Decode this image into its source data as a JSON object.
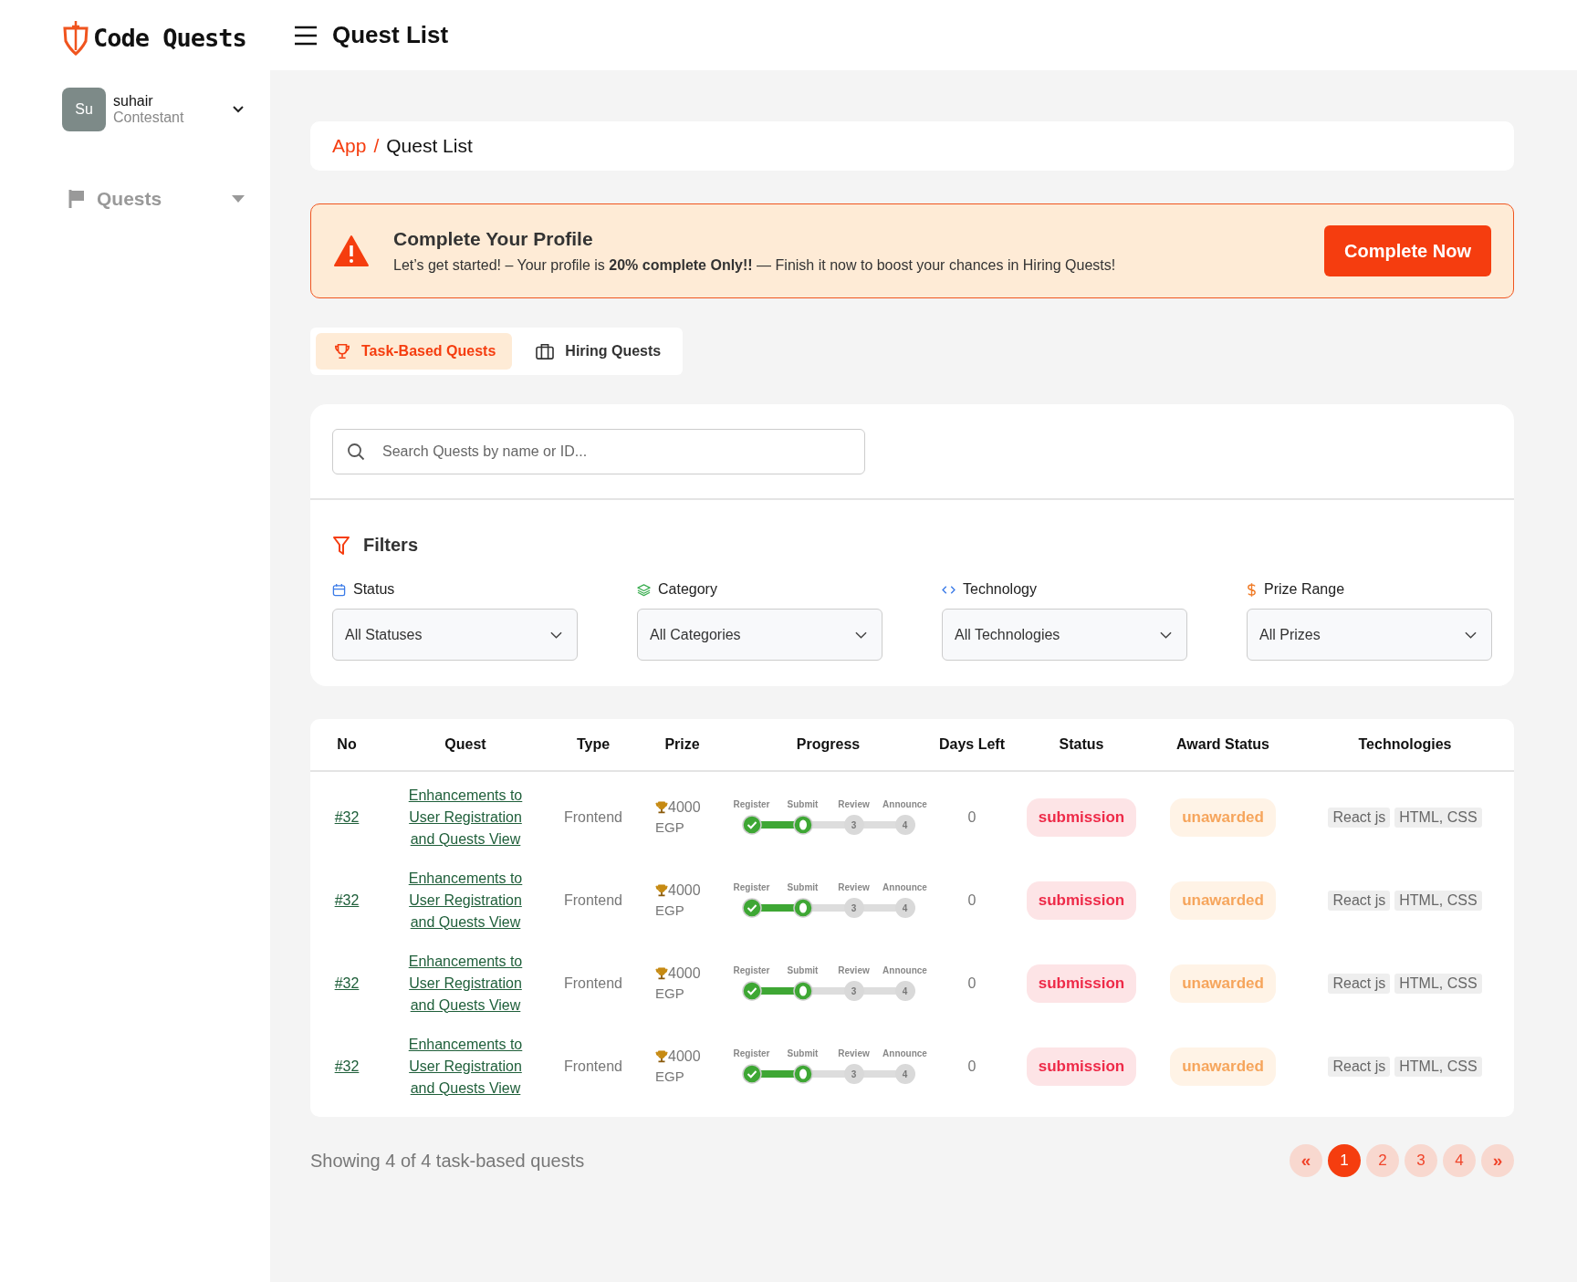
{
  "brand": {
    "name": "Code Quests"
  },
  "user": {
    "initials": "Su",
    "name": "suhair",
    "role": "Contestant"
  },
  "sidebar": {
    "items": [
      {
        "label": "Quests",
        "expanded": false
      }
    ]
  },
  "header": {
    "title": "Quest List"
  },
  "breadcrumb": [
    {
      "label": "App",
      "kind": "link"
    },
    {
      "label": "/",
      "kind": "separator"
    },
    {
      "label": "Quest List",
      "kind": "current"
    }
  ],
  "alert": {
    "title": "Complete Your Profile",
    "message": "Let’s get started! – Your profile is **20% complete Only!!** — Finish it now to boost your chances in Hiring Quests!",
    "button": "Complete Now"
  },
  "tabs": [
    {
      "label": "Task-Based Quests",
      "kind": "trophy",
      "selected": true
    },
    {
      "label": "Hiring Quests",
      "kind": "briefcase",
      "selected": false
    }
  ],
  "search": {
    "placeholder": "Search Quests by name or ID..."
  },
  "filters": {
    "title": "Filters",
    "items": [
      {
        "label": "Status",
        "kind": "calendar",
        "value": "All Statuses"
      },
      {
        "label": "Category",
        "kind": "layers",
        "value": "All Categories"
      },
      {
        "label": "Technology",
        "kind": "code",
        "value": "All Technologies"
      },
      {
        "label": "Prize Range",
        "kind": "dollar",
        "value": "All Prizes"
      }
    ]
  },
  "table": {
    "columns": [
      "No",
      "Quest",
      "Type",
      "Prize",
      "Progress",
      "Days Left",
      "Status",
      "Award Status",
      "Technologies"
    ],
    "rows": [
      {
        "no": "#32",
        "quest": "Enhancements to User Registration and Quests View",
        "type": "Frontend",
        "prize": "4000",
        "currency": "EGP",
        "steps": [
          {
            "label": "Register",
            "kind": "done"
          },
          {
            "label": "Submit",
            "kind": "current"
          },
          {
            "label": "Review",
            "kind": "pending",
            "number": "3"
          },
          {
            "label": "Announce",
            "kind": "pending",
            "number": "4"
          }
        ],
        "days_left": "0",
        "status": "submission",
        "award_status": "unawarded",
        "technologies": [
          "React js",
          "HTML, CSS"
        ]
      },
      {
        "no": "#32",
        "quest": "Enhancements to User Registration and Quests View",
        "type": "Frontend",
        "prize": "4000",
        "currency": "EGP",
        "steps": [
          {
            "label": "Register",
            "kind": "done"
          },
          {
            "label": "Submit",
            "kind": "current"
          },
          {
            "label": "Review",
            "kind": "pending",
            "number": "3"
          },
          {
            "label": "Announce",
            "kind": "pending",
            "number": "4"
          }
        ],
        "days_left": "0",
        "status": "submission",
        "award_status": "unawarded",
        "technologies": [
          "React js",
          "HTML, CSS"
        ]
      },
      {
        "no": "#32",
        "quest": "Enhancements to User Registration and Quests View",
        "type": "Frontend",
        "prize": "4000",
        "currency": "EGP",
        "steps": [
          {
            "label": "Register",
            "kind": "done"
          },
          {
            "label": "Submit",
            "kind": "current"
          },
          {
            "label": "Review",
            "kind": "pending",
            "number": "3"
          },
          {
            "label": "Announce",
            "kind": "pending",
            "number": "4"
          }
        ],
        "days_left": "0",
        "status": "submission",
        "award_status": "unawarded",
        "technologies": [
          "React js",
          "HTML, CSS"
        ]
      },
      {
        "no": "#32",
        "quest": "Enhancements to User Registration and Quests View",
        "type": "Frontend",
        "prize": "4000",
        "currency": "EGP",
        "steps": [
          {
            "label": "Register",
            "kind": "done"
          },
          {
            "label": "Submit",
            "kind": "current"
          },
          {
            "label": "Review",
            "kind": "pending",
            "number": "3"
          },
          {
            "label": "Announce",
            "kind": "pending",
            "number": "4"
          }
        ],
        "days_left": "0",
        "status": "submission",
        "award_status": "unawarded",
        "technologies": [
          "React js",
          "HTML, CSS"
        ]
      }
    ]
  },
  "footer": {
    "summary": "Showing 4 of 4 task-based quests"
  },
  "pagination": [
    {
      "label": "«",
      "kind": "prev",
      "selected": false
    },
    {
      "label": "1",
      "kind": "page",
      "selected": true
    },
    {
      "label": "2",
      "kind": "page",
      "selected": false
    },
    {
      "label": "3",
      "kind": "page",
      "selected": false
    },
    {
      "label": "4",
      "kind": "page",
      "selected": false
    },
    {
      "label": "»",
      "kind": "next",
      "selected": false
    }
  ]
}
